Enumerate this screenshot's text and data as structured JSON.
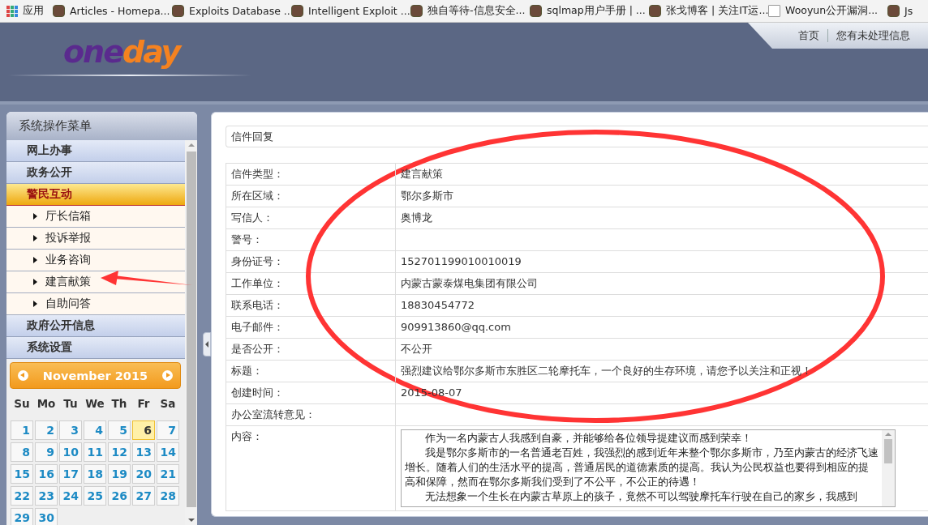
{
  "bookmarks": [
    {
      "label": "应用",
      "kind": "apps"
    },
    {
      "label": "Articles - Homepa...",
      "kind": "site"
    },
    {
      "label": "Exploits Database ...",
      "kind": "site"
    },
    {
      "label": "Intelligent Exploit ...",
      "kind": "site"
    },
    {
      "label": "独自等待-信息安全...",
      "kind": "site"
    },
    {
      "label": "sqlmap用户手册 | ...",
      "kind": "site"
    },
    {
      "label": "张戈博客 | 关注IT运...",
      "kind": "site"
    },
    {
      "label": "Wooyun公开漏洞...",
      "kind": "page"
    },
    {
      "label": "Js",
      "kind": "site"
    }
  ],
  "header": {
    "logo": [
      "one",
      "day"
    ],
    "nav": [
      "首页",
      "您有未处理信息"
    ]
  },
  "sidebar": {
    "title": "系统操作菜单",
    "menu": [
      {
        "label": "网上办事",
        "expanded": false
      },
      {
        "label": "政务公开",
        "expanded": false
      },
      {
        "label": "警民互动",
        "expanded": true,
        "children": [
          {
            "label": "厅长信箱"
          },
          {
            "label": "投诉举报"
          },
          {
            "label": "业务咨询"
          },
          {
            "label": "建言献策"
          },
          {
            "label": "自助问答"
          }
        ]
      },
      {
        "label": "政府公开信息",
        "expanded": false
      },
      {
        "label": "系统设置",
        "expanded": false
      }
    ]
  },
  "calendar": {
    "month": "November 2015",
    "weekdays": [
      "Su",
      "Mo",
      "Tu",
      "We",
      "Th",
      "Fr",
      "Sa"
    ],
    "days": [
      {
        "label": "1",
        "selected": false
      },
      {
        "label": "2",
        "selected": false
      },
      {
        "label": "3",
        "selected": false
      },
      {
        "label": "4",
        "selected": false
      },
      {
        "label": "5",
        "selected": false
      },
      {
        "label": "6",
        "selected": true
      },
      {
        "label": "7",
        "selected": false
      },
      {
        "label": "8",
        "selected": false
      },
      {
        "label": "9",
        "selected": false
      },
      {
        "label": "10",
        "selected": false
      },
      {
        "label": "11",
        "selected": false
      },
      {
        "label": "12",
        "selected": false
      },
      {
        "label": "13",
        "selected": false
      },
      {
        "label": "14",
        "selected": false
      },
      {
        "label": "15",
        "selected": false
      },
      {
        "label": "16",
        "selected": false
      },
      {
        "label": "17",
        "selected": false
      },
      {
        "label": "18",
        "selected": false
      },
      {
        "label": "19",
        "selected": false
      },
      {
        "label": "20",
        "selected": false
      },
      {
        "label": "21",
        "selected": false
      },
      {
        "label": "22",
        "selected": false
      },
      {
        "label": "23",
        "selected": false
      },
      {
        "label": "24",
        "selected": false
      },
      {
        "label": "25",
        "selected": false
      },
      {
        "label": "26",
        "selected": false
      },
      {
        "label": "27",
        "selected": false
      },
      {
        "label": "28",
        "selected": false
      },
      {
        "label": "29",
        "selected": false
      },
      {
        "label": "30",
        "selected": false
      }
    ]
  },
  "letter": {
    "title": "信件回复",
    "fields": [
      {
        "label": "信件类型：",
        "value": "建言献策"
      },
      {
        "label": "所在区域：",
        "value": "鄂尔多斯市"
      },
      {
        "label": "写信人：",
        "value": "奥博龙"
      },
      {
        "label": "警号："
      },
      {
        "label": "身份证号：",
        "value": "152701199010010019"
      },
      {
        "label": "工作单位：",
        "value": "内蒙古蒙泰煤电集团有限公司"
      },
      {
        "label": "联系电话：",
        "value": "18830454772"
      },
      {
        "label": "电子邮件：",
        "value": "909913860@qq.com"
      },
      {
        "label": "是否公开：",
        "value": "不公开"
      },
      {
        "label": "标题：",
        "value": "强烈建议给鄂尔多斯市东胜区二轮摩托车，一个良好的生存环境，请您予以关注和正视！"
      },
      {
        "label": "创建时间：",
        "value": "2015-08-07"
      },
      {
        "label": "办公室流转意见："
      }
    ],
    "content": {
      "label": "内容：",
      "paragraphs": [
        "作为一名内蒙古人我感到自豪，并能够给各位领导提建议而感到荣幸！",
        "我是鄂尔多斯市的一名普通老百姓，我强烈的感到近年来整个鄂尔多斯市，乃至内蒙古的经济飞速增长。随着人们的生活水平的提高，普通居民的道德素质的提高。我认为公民权益也要得到相应的提高和保障，然而在鄂尔多斯我们受到了不公平，不公正的待遇！",
        "无法想象一个生长在内蒙古草原上的孩子，竟然不可以驾驶摩托车行驶在自己的家乡，我感到"
      ]
    }
  }
}
